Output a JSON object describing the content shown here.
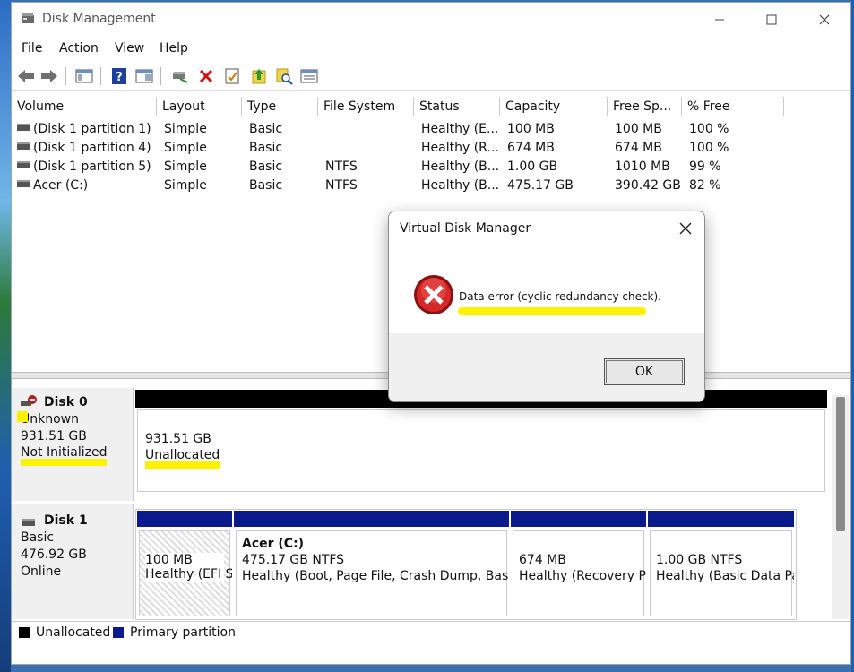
{
  "window": {
    "title": "Disk Management",
    "controls": {
      "minimize": "minimize",
      "maximize": "maximize",
      "close": "close"
    }
  },
  "menu": [
    "File",
    "Action",
    "View",
    "Help"
  ],
  "toolbar": [
    "back-icon",
    "forward-icon",
    "show-hide-console-tree-icon",
    "help-icon",
    "properties-icon",
    "connect-disk-icon",
    "delete-icon",
    "check-icon",
    "up-icon",
    "search-icon",
    "list-view-icon"
  ],
  "volume_table": {
    "columns": [
      "Volume",
      "Layout",
      "Type",
      "File System",
      "Status",
      "Capacity",
      "Free Sp...",
      "% Free"
    ],
    "rows": [
      [
        "(Disk 1 partition 1)",
        "Simple",
        "Basic",
        "",
        "Healthy (E...",
        "100 MB",
        "100 MB",
        "100 %"
      ],
      [
        "(Disk 1 partition 4)",
        "Simple",
        "Basic",
        "",
        "Healthy (R...",
        "674 MB",
        "674 MB",
        "100 %"
      ],
      [
        "(Disk 1 partition 5)",
        "Simple",
        "Basic",
        "NTFS",
        "Healthy (B...",
        "1.00 GB",
        "1010 MB",
        "99 %"
      ],
      [
        "Acer (C:)",
        "Simple",
        "Basic",
        "NTFS",
        "Healthy (B...",
        "475.17 GB",
        "390.42 GB",
        "82 %"
      ]
    ]
  },
  "disks": {
    "disk0": {
      "name": "Disk 0",
      "type": "Unknown",
      "size": "931.51 GB",
      "status": "Not Initialized",
      "partition": {
        "size": "931.51 GB",
        "label": "Unallocated"
      }
    },
    "disk1": {
      "name": "Disk 1",
      "type": "Basic",
      "size": "476.92 GB",
      "status": "Online",
      "partitions": [
        {
          "title": "",
          "size": "100 MB",
          "status": "Healthy (EFI S"
        },
        {
          "title": "Acer  (C:)",
          "size": "475.17 GB NTFS",
          "status": "Healthy (Boot, Page File, Crash Dump, Basic"
        },
        {
          "title": "",
          "size": "674 MB",
          "status": "Healthy (Recovery P"
        },
        {
          "title": "",
          "size": "1.00 GB NTFS",
          "status": "Healthy (Basic Data Pa"
        }
      ]
    }
  },
  "legend": [
    {
      "label": "Unallocated",
      "color": "#000000"
    },
    {
      "label": "Primary partition",
      "color": "#00008b"
    }
  ],
  "dialog": {
    "title": "Virtual Disk Manager",
    "message": "Data error (cyclic redundancy check).",
    "ok_label": "OK",
    "icon": "error-icon"
  },
  "colors": {
    "primary_partition": "#0a1a8c",
    "unallocated": "#000000",
    "highlight": "#fff200"
  }
}
